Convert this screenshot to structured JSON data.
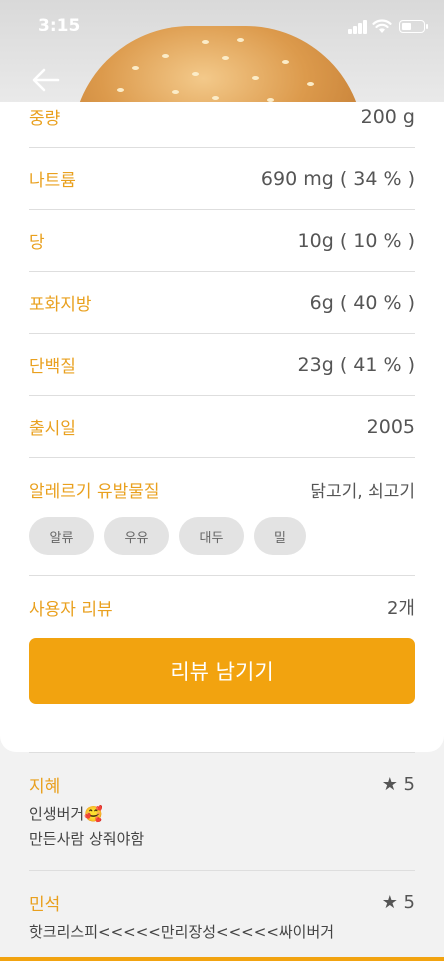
{
  "status_bar": {
    "time": "3:15"
  },
  "details": [
    {
      "label": "중량",
      "value": "200 g"
    },
    {
      "label": "나트륨",
      "value": "690 mg ( 34 % )"
    },
    {
      "label": "당",
      "value": "10g ( 10 % )"
    },
    {
      "label": "포화지방",
      "value": "6g ( 40 % )"
    },
    {
      "label": "단백질",
      "value": "23g ( 41 % )"
    },
    {
      "label": "출시일",
      "value": "2005"
    },
    {
      "label": "알레르기 유발물질",
      "value": "닭고기, 쇠고기"
    }
  ],
  "allergens": [
    "알류",
    "우유",
    "대두",
    "밀"
  ],
  "reviews_section": {
    "label": "사용자 리뷰",
    "count": "2개",
    "button_label": "리뷰 남기기"
  },
  "reviews": [
    {
      "name": "지혜",
      "rating": "★ 5",
      "lines": [
        "인생버거🥰",
        "만든사람 상줘야함"
      ]
    },
    {
      "name": "민석",
      "rating": "★ 5",
      "lines": [
        "핫크리스피<<<<<만리장성<<<<<싸이버거"
      ]
    }
  ],
  "colors": {
    "accent": "#f2a30f",
    "label": "#e9a01e"
  }
}
